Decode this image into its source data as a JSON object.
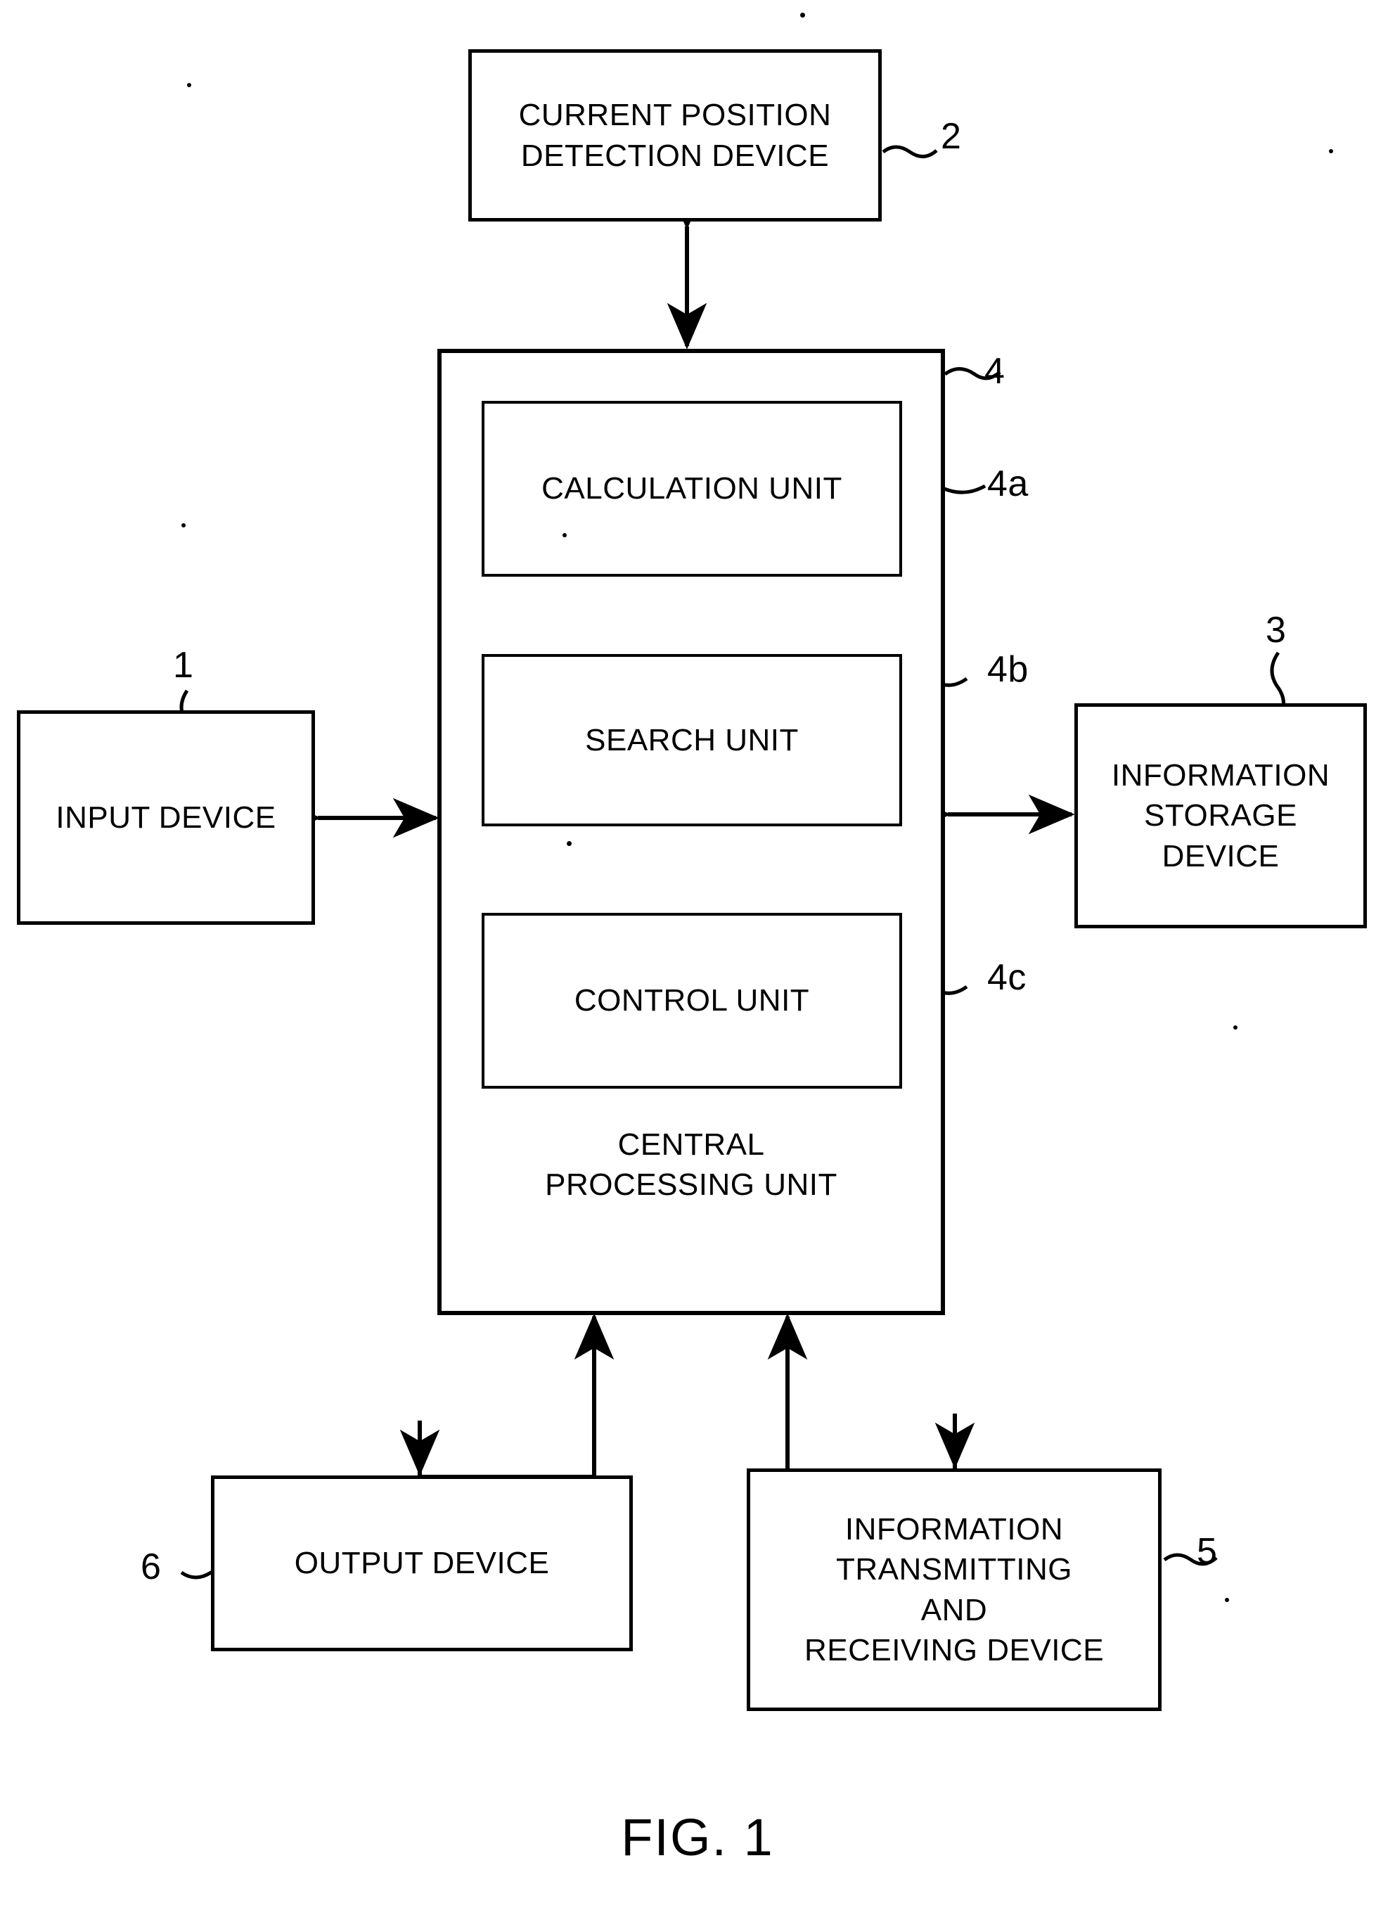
{
  "figure": {
    "caption": "FIG. 1",
    "type": "patent-block-diagram"
  },
  "blocks": {
    "current_position_detection_device": {
      "label": "CURRENT POSITION\nDETECTION DEVICE",
      "ref": "2"
    },
    "central_processing_unit": {
      "label": "CENTRAL\nPROCESSING UNIT",
      "ref": "4"
    },
    "calculation_unit": {
      "label": "CALCULATION UNIT",
      "ref": "4a"
    },
    "search_unit": {
      "label": "SEARCH UNIT",
      "ref": "4b"
    },
    "control_unit": {
      "label": "CONTROL UNIT",
      "ref": "4c"
    },
    "input_device": {
      "label": "INPUT DEVICE",
      "ref": "1"
    },
    "information_storage_device": {
      "label": "INFORMATION\nSTORAGE\nDEVICE",
      "ref": "3"
    },
    "output_device": {
      "label": "OUTPUT DEVICE",
      "ref": "6"
    },
    "information_transmitting_and_receiving_device": {
      "label": "INFORMATION\nTRANSMITTING\nAND\nRECEIVING DEVICE",
      "ref": "5"
    }
  },
  "connections": [
    {
      "from": "central_processing_unit",
      "to": "current_position_detection_device",
      "arrow": "bidirectional",
      "orientation": "vertical"
    },
    {
      "from": "input_device",
      "to": "central_processing_unit",
      "arrow": "bidirectional",
      "orientation": "horizontal"
    },
    {
      "from": "central_processing_unit",
      "to": "information_storage_device",
      "arrow": "bidirectional",
      "orientation": "horizontal"
    },
    {
      "from": "central_processing_unit",
      "to": "output_device",
      "arrow": "bidirectional-branch",
      "orientation": "vertical-elbow"
    },
    {
      "from": "central_processing_unit",
      "to": "information_transmitting_and_receiving_device",
      "arrow": "bidirectional-branch",
      "orientation": "vertical-elbow"
    }
  ],
  "colors": {
    "ink": "#000000",
    "paper": "#ffffff"
  }
}
